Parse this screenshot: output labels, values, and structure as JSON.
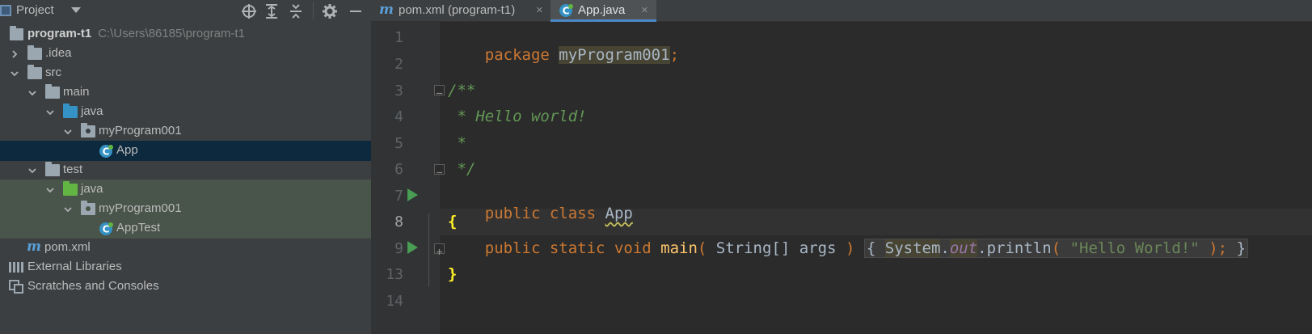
{
  "project_pane": {
    "title": "Project",
    "tree": [
      {
        "label": "program-t1",
        "path": "C:\\Users\\86185\\program-t1"
      },
      {
        "label": ".idea"
      },
      {
        "label": "src"
      },
      {
        "label": "main"
      },
      {
        "label": "java"
      },
      {
        "label": "myProgram001"
      },
      {
        "label": "App"
      },
      {
        "label": "test"
      },
      {
        "label": "java"
      },
      {
        "label": "myProgram001"
      },
      {
        "label": "AppTest"
      },
      {
        "label": "pom.xml"
      },
      {
        "label": "External Libraries"
      },
      {
        "label": "Scratches and Consoles"
      }
    ]
  },
  "tabs": [
    {
      "label": "pom.xml (program-t1)",
      "icon": "maven-icon",
      "close": "×"
    },
    {
      "label": "App.java",
      "icon": "java-class-icon",
      "close": "×",
      "active": true
    }
  ],
  "editor": {
    "line_numbers": [
      "1",
      "2",
      "3",
      "4",
      "5",
      "6",
      "7",
      "8",
      "9",
      "13",
      "14"
    ],
    "current_line": "8",
    "code": {
      "l1_kw": "package",
      "l1_pkg": "myProgram001",
      "l1_semi": ";",
      "l3": "/**",
      "l4": " * Hello world!",
      "l5": " *",
      "l6": " */",
      "l7_kw": "public class",
      "l7_name": "App",
      "l8": "{",
      "l9_kw": "public static void",
      "l9_method": "main",
      "l9_open": "(",
      "l9_params": " String[] args ",
      "l9_close": ")",
      "l9_lbrace": "{",
      "l9_system": "System",
      "l9_dot1": ".",
      "l9_out": "out",
      "l9_println": ".println",
      "l9_popen": "(",
      "l9_str": "\"Hello World!\"",
      "l9_pclose": ")",
      "l9_semi": ";",
      "l9_rbrace": "}",
      "l13": "}"
    }
  },
  "colors": {
    "keyword": "#cc7832",
    "comment": "#629755",
    "string": "#6a8759",
    "method": "#ffc66d",
    "field": "#9876aa",
    "selection": "#0d293e",
    "test_folder_bg": "#49544a"
  }
}
